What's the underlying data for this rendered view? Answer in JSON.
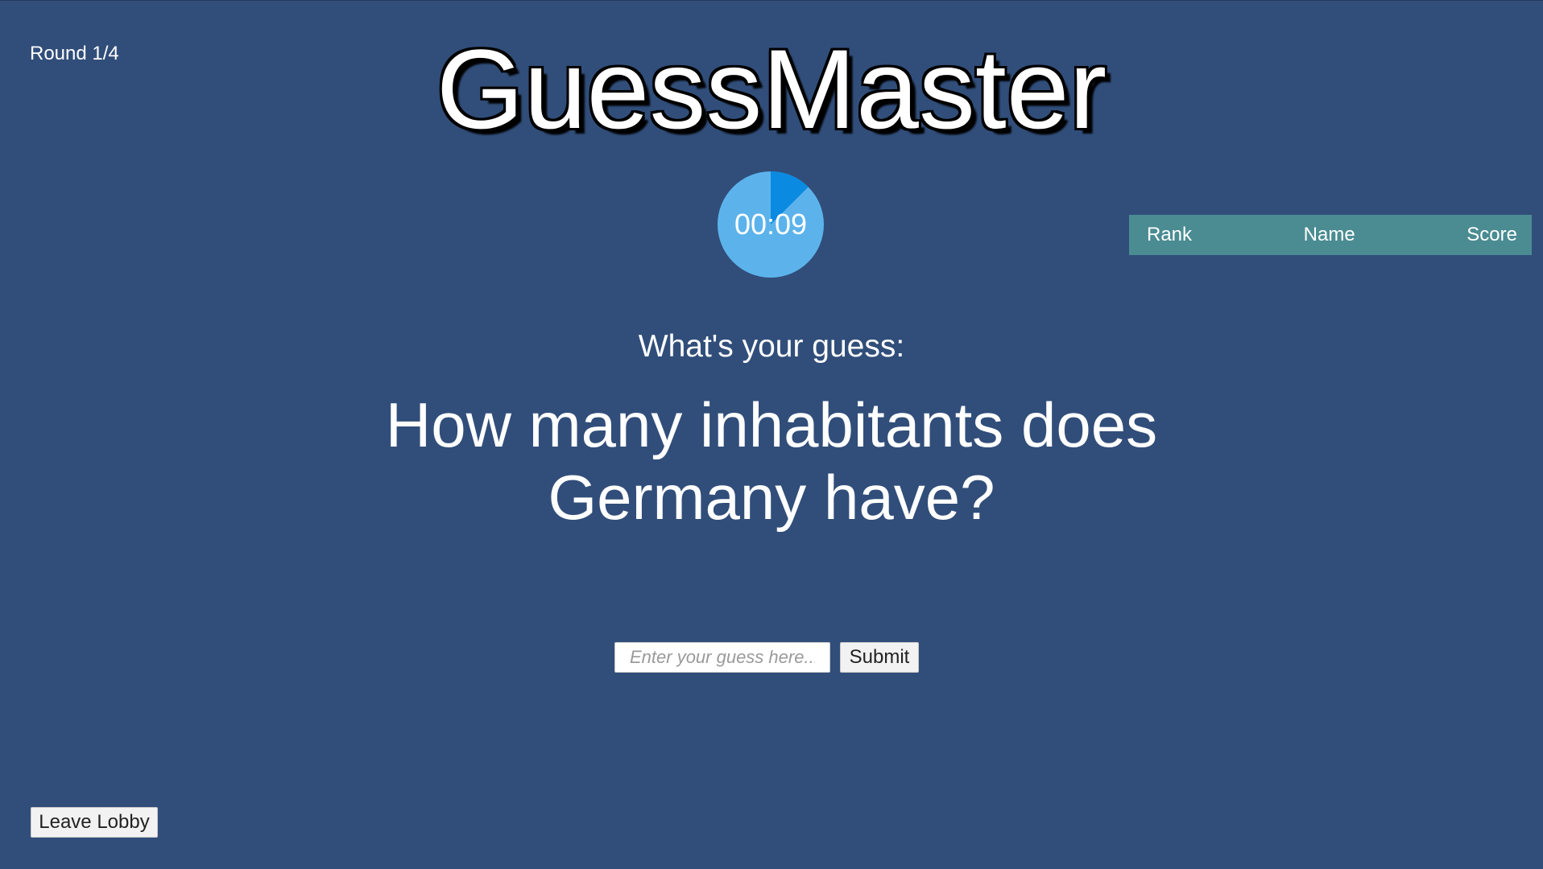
{
  "app": {
    "title": "GuessMaster",
    "round_label": "Round 1/4"
  },
  "timer": {
    "display": "00:09",
    "elapsed_fraction": 0.125,
    "colors": {
      "remaining": "#5cb3ec",
      "elapsed": "#0a8ae0"
    }
  },
  "question": {
    "prompt": "What's your guess:",
    "text": "How many inhabitants does Germany have?"
  },
  "guess": {
    "placeholder": "Enter your guess here...",
    "value": "",
    "submit_label": "Submit"
  },
  "leaderboard": {
    "columns": [
      "Rank",
      "Name",
      "Score"
    ],
    "rows": []
  },
  "footer": {
    "leave_label": "Leave Lobby"
  },
  "colors": {
    "background": "#314e7a",
    "leaderboard_header": "#4a8c92"
  }
}
